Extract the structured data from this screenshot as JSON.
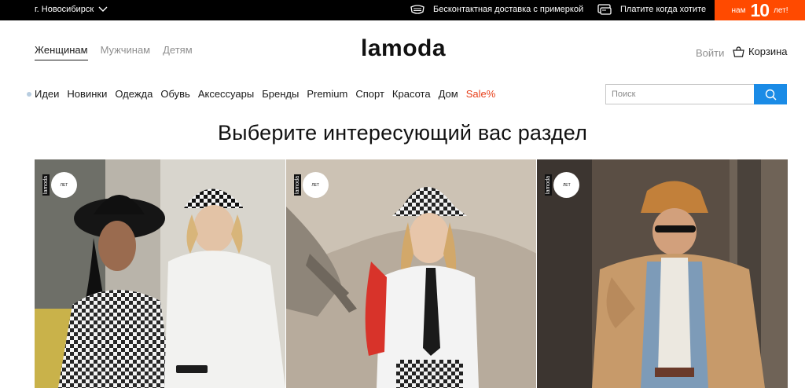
{
  "topbar": {
    "city": "г. Новосибирск",
    "promo_delivery": "Бесконтактная доставка с примеркой",
    "promo_pay": "Платите когда хотите",
    "anniversary": {
      "prefix": "нам",
      "number": "10",
      "suffix": "лет!"
    }
  },
  "header": {
    "gender_tabs": [
      "Женщинам",
      "Мужчинам",
      "Детям"
    ],
    "logo_la": "la",
    "logo_moda": "moda",
    "login": "Войти",
    "cart": "Корзина"
  },
  "nav": {
    "items": [
      "Идеи",
      "Новинки",
      "Одежда",
      "Обувь",
      "Аксессуары",
      "Бренды",
      "Premium",
      "Спорт",
      "Красота",
      "Дом",
      "Sale%"
    ]
  },
  "search": {
    "placeholder": "Поиск"
  },
  "main": {
    "heading": "Выберите интересующий вас раздел",
    "cards": [
      {
        "badge_vertical": "lamoda",
        "badge_circle": "ЛЕТ"
      },
      {
        "badge_vertical": "lamoda",
        "badge_circle": "ЛЕТ"
      },
      {
        "badge_vertical": "lamoda",
        "badge_circle": "ЛЕТ"
      }
    ]
  },
  "colors": {
    "accent_orange": "#ff4a00",
    "sale": "#e7401b",
    "search_button": "#1a8be6"
  }
}
